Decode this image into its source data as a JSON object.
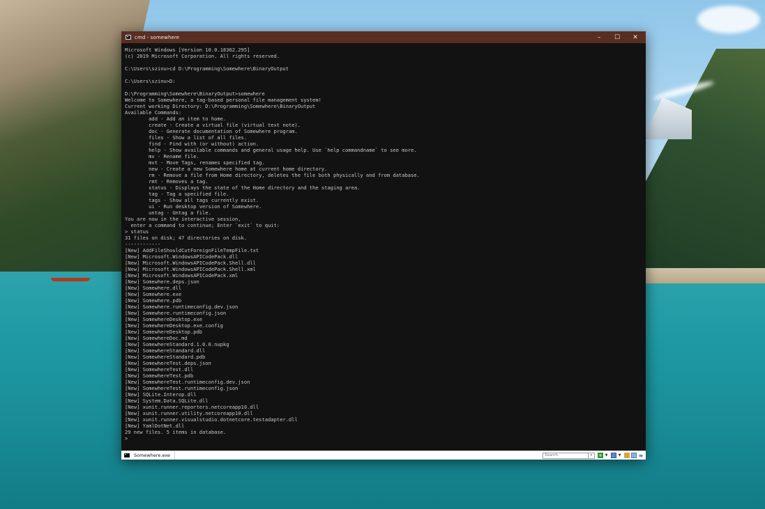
{
  "window": {
    "title": "cmd - somewhere",
    "minimize_glyph": "–",
    "maximize_glyph": "☐",
    "close_glyph": "✕"
  },
  "console": {
    "lines": [
      "Microsoft Windows [Version 10.0.18362.295]",
      "(c) 2019 Microsoft Corporation. All rights reserved.",
      "",
      "C:\\Users\\szinu>cd D:\\Programming\\Somewhere\\BinaryOutput",
      "",
      "C:\\Users\\szinu>D:",
      "",
      "D:\\Programming\\Somewhere\\BinaryOutput>somewhere",
      "Welcome to Somewhere, a tag-based personal file management system!",
      "Current working Directory: D:\\Programming\\Somewhere\\BinaryOutput",
      "Available Commands:",
      "        add - Add an item to home.",
      "        create - Create a virtual file (virtual text note).",
      "        doc - Generate documentation of Somewhere program.",
      "        files - Show a list of all files.",
      "        find - Find with (or without) action.",
      "        help - Show available commands and general usage help. Use `help commandname` to see more.",
      "        mv - Rename file.",
      "        mvt - Move Tags, renames specified tag.",
      "        new - Create a new Somewhere home at current home directory.",
      "        rm - Remove a file from Home directory, deletes the file both physically and from database.",
      "        rmt - Removes a tag.",
      "        status - Displays the state of the Home directory and the staging area.",
      "        tag - Tag a specified file.",
      "        tags - Show all tags currently exist.",
      "        ui - Run desktop version of Somewhere.",
      "        untag - Untag a file.",
      "You are now in the interactive session,",
      "  enter a command to continue; Enter `exit` to quit:",
      "> status",
      "31 files on disk; 47 directories on disk.",
      "------------",
      "[New] AddFileShouldCutForeignFileTempFile.txt",
      "[New] Microsoft.WindowsAPICodePack.dll",
      "[New] Microsoft.WindowsAPICodePack.Shell.dll",
      "[New] Microsoft.WindowsAPICodePack.Shell.xml",
      "[New] Microsoft.WindowsAPICodePack.xml",
      "[New] Somewhere.deps.json",
      "[New] Somewhere.dll",
      "[New] Somewhere.exe",
      "[New] Somewhere.pdb",
      "[New] Somewhere.runtimeconfig.dev.json",
      "[New] Somewhere.runtimeconfig.json",
      "[New] SomewhereDesktop.exe",
      "[New] SomewhereDesktop.exe.config",
      "[New] SomewhereDesktop.pdb",
      "[New] SomewhereDoc.md",
      "[New] SomewhereStandard.1.0.0.nupkg",
      "[New] SomewhereStandard.dll",
      "[New] SomewhereStandard.pdb",
      "[New] SomewhereTest.deps.json",
      "[New] SomewhereTest.dll",
      "[New] SomewhereTest.pdb",
      "[New] SomewhereTest.runtimeconfig.dev.json",
      "[New] SomewhereTest.runtimeconfig.json",
      "[New] SQLite.Interop.dll",
      "[New] System.Data.SQLite.dll",
      "[New] xunit.runner.reporters.netcoreapp10.dll",
      "[New] xunit.runner.utility.netcoreapp10.dll",
      "[New] xunit.runner.visualstudio.dotnetcore.testadapter.dll",
      "[New] YamlDotNet.dll",
      "29 new files. 5 items in database.",
      ">"
    ]
  },
  "tabbar": {
    "tab_label": "Somewhere.exe",
    "search_placeholder": "Search",
    "search_icon": "magnifier-icon",
    "icons": [
      "new-console-icon",
      "dropdown-arrow-icon",
      "console-view-icon",
      "dropdown-arrow-icon",
      "lock-icon",
      "panel-icon",
      "menu-icon"
    ]
  }
}
